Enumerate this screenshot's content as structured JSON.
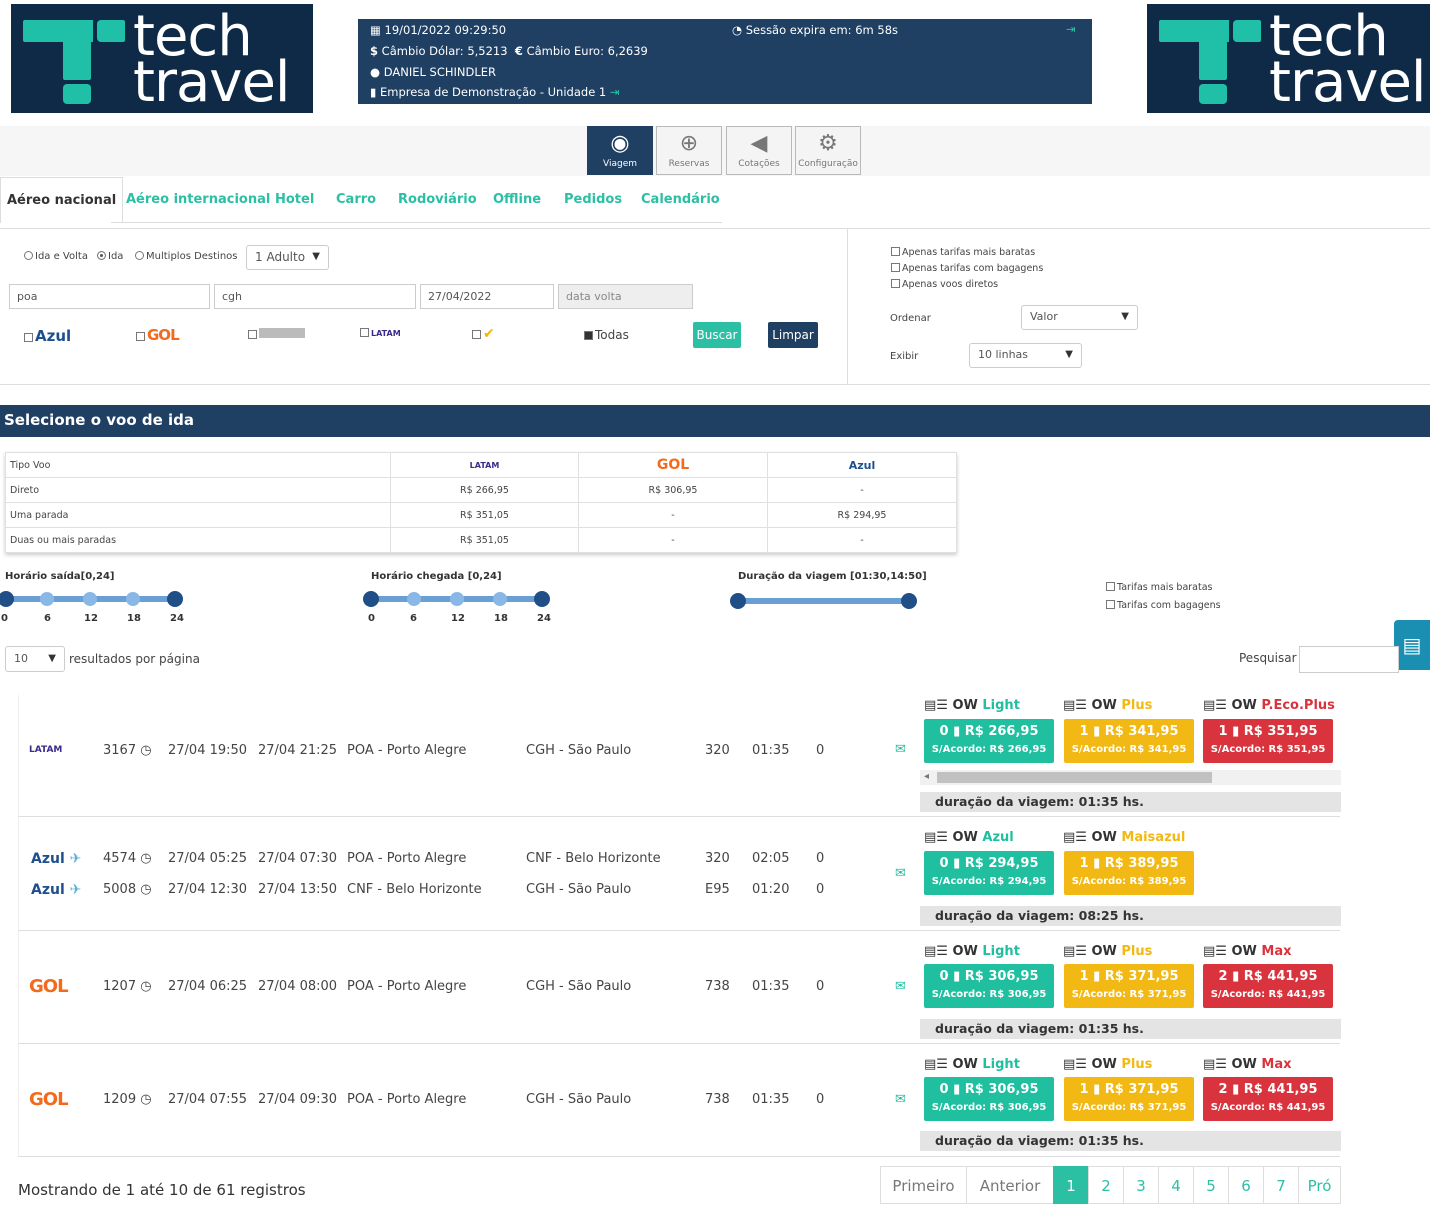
{
  "logo": {
    "line1": "tech",
    "line2": "travel"
  },
  "info": {
    "datetime": "19/01/2022 09:29:50",
    "dolar": "Câmbio Dólar: 5,5213",
    "euro": "Câmbio Euro: 6,2639",
    "user": "DANIEL SCHINDLER",
    "company": "Empresa de Demonstração - Unidade 1",
    "session": "Sessão expira em: 6m 58s"
  },
  "nav": [
    "Viagem",
    "Reservas",
    "Cotações",
    "Configuração"
  ],
  "tabs": [
    "Aéreo nacional",
    "Aéreo internacional",
    "Hotel",
    "Carro",
    "Rodoviário",
    "Offline",
    "Pedidos",
    "Calendário"
  ],
  "search": {
    "trip_types": [
      "Ida e Volta",
      "Ida",
      "Multiplos Destinos"
    ],
    "passengers": "1 Adulto",
    "origin": "poa",
    "destination": "cgh",
    "date_out": "27/04/2022",
    "date_back_placeholder": "data volta",
    "airlines": [
      "Azul",
      "GOL",
      "",
      "LATAM",
      ""
    ],
    "all_label": "Todas",
    "search_btn": "Buscar",
    "clear_btn": "Limpar"
  },
  "filters": {
    "options": [
      "Apenas tarifas mais baratas",
      "Apenas tarifas com bagagens",
      "Apenas voos diretos"
    ],
    "order_label": "Ordenar",
    "order_value": "Valor",
    "show_label": "Exibir",
    "show_value": "10 linhas"
  },
  "banner": "Selecione o voo de ida",
  "compare": {
    "header": [
      "Tipo Voo",
      "LATAM",
      "GOL",
      "Azul"
    ],
    "rows": [
      [
        "Direto",
        "R$ 266,95",
        "R$ 306,95",
        "-"
      ],
      [
        "Uma parada",
        "R$ 351,05",
        "-",
        "R$ 294,95"
      ],
      [
        "Duas ou mais paradas",
        "R$ 351,05",
        "-",
        "-"
      ]
    ]
  },
  "sliders": {
    "dep": "Horário saída[0,24]",
    "arr": "Horário chegada [0,24]",
    "dur": "Duração da viagem [01:30,14:50]",
    "ticks": [
      "0",
      "6",
      "12",
      "18",
      "24"
    ]
  },
  "side_filters": [
    "Tarifas mais baratas",
    "Tarifas com bagagens"
  ],
  "table_ctrl": {
    "per_page": "10",
    "per_page_label": "resultados por página",
    "search_label": "Pesquisar"
  },
  "flights": [
    {
      "legs": [
        {
          "airline": "LATAM",
          "num": "3167",
          "dep": "27/04 19:50",
          "arr": "27/04 21:25",
          "from": "POA - Porto Alegre",
          "to": "CGH - São Paulo",
          "eq": "320",
          "dur": "01:35",
          "stops": "0"
        }
      ],
      "fares": [
        {
          "name": "OW",
          "brand": "Light",
          "bags": "0",
          "price": "R$ 266,95",
          "agree": "S/Acordo: R$ 266,95",
          "color": "#1fbf9f"
        },
        {
          "name": "OW",
          "brand": "Plus",
          "bags": "1",
          "price": "R$ 341,95",
          "agree": "S/Acordo: R$ 341,95",
          "color": "#f2b814"
        },
        {
          "name": "OW",
          "brand": "P.Eco.Plus",
          "bags": "1",
          "price": "R$ 351,95",
          "agree": "S/Acordo: R$ 351,95",
          "color": "#d9343d"
        }
      ],
      "total": "duração da viagem: 01:35 hs."
    },
    {
      "legs": [
        {
          "airline": "Azul",
          "num": "4574",
          "dep": "27/04 05:25",
          "arr": "27/04 07:30",
          "from": "POA - Porto Alegre",
          "to": "CNF - Belo Horizonte",
          "eq": "320",
          "dur": "02:05",
          "stops": "0"
        },
        {
          "airline": "Azul",
          "num": "5008",
          "dep": "27/04 12:30",
          "arr": "27/04 13:50",
          "from": "CNF - Belo Horizonte",
          "to": "CGH - São Paulo",
          "eq": "E95",
          "dur": "01:20",
          "stops": "0"
        }
      ],
      "fares": [
        {
          "name": "OW",
          "brand": "Azul",
          "bags": "0",
          "price": "R$ 294,95",
          "agree": "S/Acordo: R$ 294,95",
          "color": "#1fbf9f"
        },
        {
          "name": "OW",
          "brand": "Maisazul",
          "bags": "1",
          "price": "R$ 389,95",
          "agree": "S/Acordo: R$ 389,95",
          "color": "#f2b814"
        }
      ],
      "total": "duração da viagem: 08:25 hs."
    },
    {
      "legs": [
        {
          "airline": "GOL",
          "num": "1207",
          "dep": "27/04 06:25",
          "arr": "27/04 08:00",
          "from": "POA - Porto Alegre",
          "to": "CGH - São Paulo",
          "eq": "738",
          "dur": "01:35",
          "stops": "0"
        }
      ],
      "fares": [
        {
          "name": "OW",
          "brand": "Light",
          "bags": "0",
          "price": "R$ 306,95",
          "agree": "S/Acordo: R$ 306,95",
          "color": "#1fbf9f"
        },
        {
          "name": "OW",
          "brand": "Plus",
          "bags": "1",
          "price": "R$ 371,95",
          "agree": "S/Acordo: R$ 371,95",
          "color": "#f2b814"
        },
        {
          "name": "OW",
          "brand": "Max",
          "bags": "2",
          "price": "R$ 441,95",
          "agree": "S/Acordo: R$ 441,95",
          "color": "#d9343d"
        }
      ],
      "total": "duração da viagem: 01:35 hs."
    },
    {
      "legs": [
        {
          "airline": "GOL",
          "num": "1209",
          "dep": "27/04 07:55",
          "arr": "27/04 09:30",
          "from": "POA - Porto Alegre",
          "to": "CGH - São Paulo",
          "eq": "738",
          "dur": "01:35",
          "stops": "0"
        }
      ],
      "fares": [
        {
          "name": "OW",
          "brand": "Light",
          "bags": "0",
          "price": "R$ 306,95",
          "agree": "S/Acordo: R$ 306,95",
          "color": "#1fbf9f"
        },
        {
          "name": "OW",
          "brand": "Plus",
          "bags": "1",
          "price": "R$ 371,95",
          "agree": "S/Acordo: R$ 371,95",
          "color": "#f2b814"
        },
        {
          "name": "OW",
          "brand": "Max",
          "bags": "2",
          "price": "R$ 441,95",
          "agree": "S/Acordo: R$ 441,95",
          "color": "#d9343d"
        }
      ],
      "total": "duração da viagem: 01:35 hs."
    }
  ],
  "footer": {
    "showing": "Mostrando de 1 até 10 de 61 registros",
    "pages": [
      "Primeiro",
      "Anterior",
      "1",
      "2",
      "3",
      "4",
      "5",
      "6",
      "7",
      "Pró"
    ]
  }
}
